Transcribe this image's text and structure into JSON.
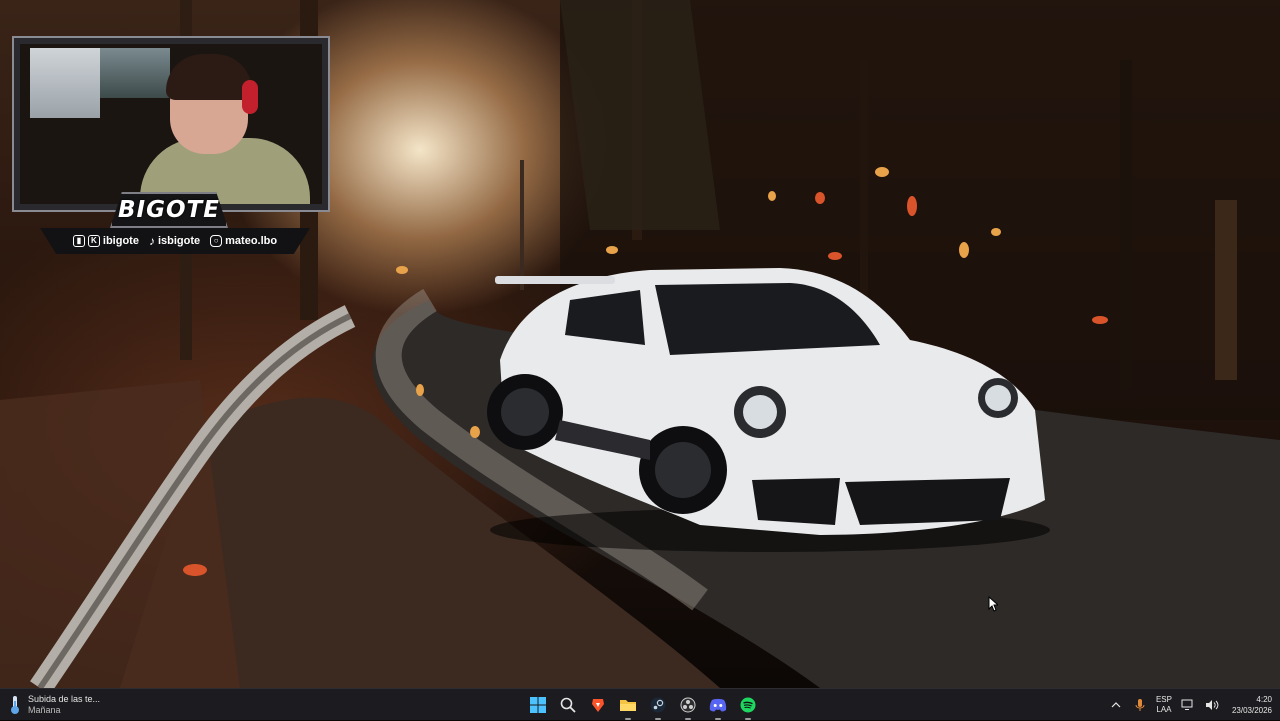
{
  "overlay": {
    "name_plate": "BIGOTE",
    "socials": [
      {
        "icon": "twitch-icon",
        "text": "ibigote"
      },
      {
        "icon": "kick-icon",
        "text": ""
      },
      {
        "icon": "tiktok-icon",
        "text": "isbigote"
      },
      {
        "icon": "instagram-icon",
        "text": "mateo.lbo"
      }
    ]
  },
  "taskbar": {
    "weather": {
      "title": "Subida de las te...",
      "subtitle": "Mañana"
    },
    "apps": [
      {
        "name": "start-button",
        "icon": "windows-icon"
      },
      {
        "name": "search-button",
        "icon": "search-icon"
      },
      {
        "name": "brave-button",
        "icon": "brave-icon"
      },
      {
        "name": "file-explorer-button",
        "icon": "folder-icon"
      },
      {
        "name": "steam-button",
        "icon": "steam-icon"
      },
      {
        "name": "obs-button",
        "icon": "obs-icon"
      },
      {
        "name": "discord-button",
        "icon": "discord-icon"
      },
      {
        "name": "spotify-button",
        "icon": "spotify-icon"
      }
    ],
    "tray": {
      "language_top": "ESP",
      "language_bottom": "LAA",
      "time": "4:20",
      "date": "23/03/2026"
    }
  },
  "colors": {
    "taskbar_bg": "#1c1b1f",
    "accent_orange": "#e8a24a",
    "spotify_green": "#1ed760",
    "discord_blue": "#5865f2",
    "brave_orange": "#fb542b"
  }
}
